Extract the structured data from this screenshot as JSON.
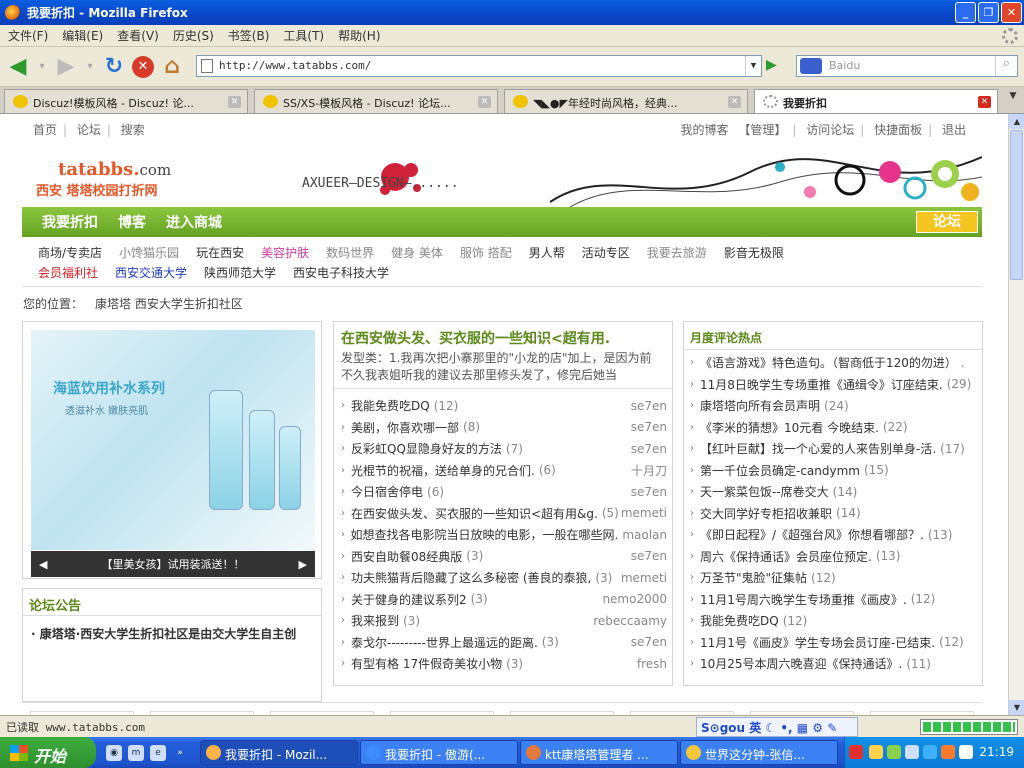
{
  "window": {
    "title": "我要折扣 - Mozilla Firefox"
  },
  "menu": [
    "文件(F)",
    "编辑(E)",
    "查看(V)",
    "历史(S)",
    "书签(B)",
    "工具(T)",
    "帮助(H)"
  ],
  "address": {
    "url": "http://www.tatabbs.com/"
  },
  "search": {
    "placeholder": "Baidu"
  },
  "tabs": [
    {
      "label": "Discuz!模板风格 - Discuz! 论..."
    },
    {
      "label": "SS/XS-模板风格 - Discuz! 论坛..."
    },
    {
      "label": "◥◣●◤年经时尚风格，经典..."
    },
    {
      "label": "我要折扣"
    }
  ],
  "page": {
    "top_left": [
      "首页",
      "论坛",
      "搜索"
    ],
    "top_right": [
      "我的博客",
      "【管理】",
      "访问论坛",
      "快捷面板",
      "退出"
    ],
    "logo_main": "tatabbs.",
    "logo_com": "com",
    "logo_sub": "西安 塔塔校园打折网",
    "banner_text": "AXUEER—DESIGN—......",
    "green_nav": [
      "我要折扣",
      "博客",
      "进入商城"
    ],
    "forum_tag": "论坛",
    "cat_row1": [
      "商场/专卖店",
      "小馋猫乐园",
      "玩在西安",
      "美容护肤",
      "数码世界",
      "健身 美体",
      "服饰 搭配",
      "男人帮",
      "活动专区",
      "我要去旅游",
      "影音无极限"
    ],
    "cat_row2": [
      "会员福利社",
      "西安交通大学",
      "陕西师范大学",
      "西安电子科技大学"
    ],
    "crumb_label": "您的位置：",
    "crumb_value": "康塔塔 西安大学生折扣社区",
    "ad": {
      "title": "海蓝饮用补水系列",
      "sub": "透滋补水 嫩肤亮肌",
      "caption": "【里美女孩】试用装派送！！"
    },
    "announce": {
      "title": "论坛公告",
      "text": "康塔塔·西安大学生折扣社区是由交大学生自主创"
    },
    "featured": {
      "title": "在西安做头发、买衣服的一些知识<超有用.",
      "desc": "发型类：1.我再次把小寨那里的\"小龙的店\"加上，是因为前不久我表姐听我的建议去那里修头发了，修完后她当"
    },
    "threads": [
      {
        "title": "我能免费吃DQ",
        "count": "(12)",
        "author": "se7en"
      },
      {
        "title": "美剧，你喜欢哪一部",
        "count": "(8)",
        "author": "se7en"
      },
      {
        "title": "反彩虹QQ显隐身好友的方法",
        "count": "(7)",
        "author": "se7en"
      },
      {
        "title": "光棍节的祝福，送给单身的兄合们.",
        "count": "(6)",
        "author": "十月刀"
      },
      {
        "title": "今日宿舍停电",
        "count": "(6)",
        "author": "se7en"
      },
      {
        "title": "在西安做头发、买衣服的一些知识<超有用&g.",
        "count": "(5)",
        "author": "memeti"
      },
      {
        "title": "如想查找各电影院当日放映的电影，一般在哪些网.",
        "count": "",
        "author": "maolan"
      },
      {
        "title": "西安自助餐08经典版",
        "count": "(3)",
        "author": "se7en"
      },
      {
        "title": "功夫熊猫背后隐藏了这么多秘密 (善良的泰狼,",
        "count": "(3)",
        "author": "memeti"
      },
      {
        "title": "关于健身的建议系列2",
        "count": "(3)",
        "author": "nemo2000"
      },
      {
        "title": "我来报到",
        "count": "(3)",
        "author": "rebeccaamy"
      },
      {
        "title": "泰戈尔---------世界上最遥远的距离.",
        "count": "(3)",
        "author": "se7en"
      },
      {
        "title": "有型有格 17件假奇美妆小物",
        "count": "(3)",
        "author": "fresh"
      }
    ],
    "hot": {
      "title": "月度评论热点",
      "items": [
        {
          "title": "《语言游戏》特色造句。（智商低于120的勿进）",
          "count": "."
        },
        {
          "title": "11月8日晚学生专场重推《通缉令》订座结束.",
          "count": "(29)"
        },
        {
          "title": "康塔塔向所有会员声明",
          "count": "(24)"
        },
        {
          "title": "《李米的猜想》10元看 今晚结束.",
          "count": "(22)"
        },
        {
          "title": "【红叶巨献】找一个心爱的人来告别单身-活.",
          "count": "(17)"
        },
        {
          "title": "第一千位会员确定-candymm",
          "count": "(15)"
        },
        {
          "title": "天一紫菜包饭--席卷交大",
          "count": "(14)"
        },
        {
          "title": "交大同学好专柜招收兼职",
          "count": "(14)"
        },
        {
          "title": "《即日起程》/《超强台风》你想看哪部？.",
          "count": "(13)"
        },
        {
          "title": "周六《保持通话》会员座位预定.",
          "count": "(13)"
        },
        {
          "title": "万圣节\"鬼脸\"征集帖",
          "count": "(12)"
        },
        {
          "title": "11月1号周六晚学生专场重推《画皮》.",
          "count": "(12)"
        },
        {
          "title": "我能免费吃DQ",
          "count": "(12)"
        },
        {
          "title": "11月1号《画皮》学生专场会员订座-已结束.",
          "count": "(12)"
        },
        {
          "title": "10月25号本周六晚喜迎《保持通话》.",
          "count": "(11)"
        }
      ]
    }
  },
  "status": {
    "text": "已读取 www.tatabbs.com",
    "ime": "S⊙gou 英 ☾ •, ▦ ⚙ ✎",
    "progress": 1.0
  },
  "taskbar": {
    "start": "开始",
    "buttons": [
      {
        "label": "我要折扣 - Mozil..."
      },
      {
        "label": "我要折扣 - 傲游(..."
      },
      {
        "label": "ktt康塔塔管理者 ..."
      },
      {
        "label": "世界这分钟-张信..."
      }
    ],
    "clock": "21:19"
  },
  "colors": {
    "accent_green": "#63a322",
    "title_orange": "#e6582a",
    "xp_blue": "#245edb"
  }
}
